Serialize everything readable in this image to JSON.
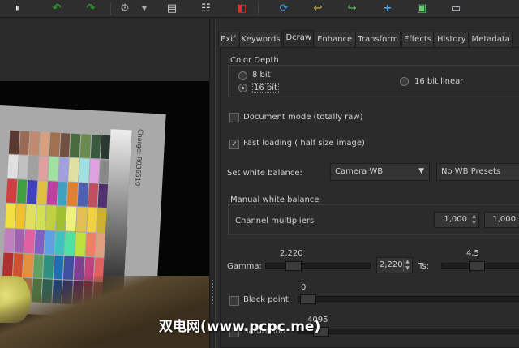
{
  "toolbar": {
    "icons": [
      "pause-icon",
      "rotate-left-icon",
      "rotate-right-icon",
      "gear-icon",
      "dropdown-arrow-icon",
      "document-icon",
      "list-add-icon",
      "exit-icon",
      "refresh-icon",
      "undo-icon",
      "redo-icon",
      "plus-icon",
      "image-icon",
      "battery-icon"
    ]
  },
  "tabs": [
    "Exif",
    "Keywords",
    "Dcraw",
    "Enhance",
    "Transform",
    "Effects",
    "History",
    "Metadata"
  ],
  "active_tab": "Dcraw",
  "dcraw": {
    "color_depth": {
      "title": "Color Depth",
      "options": [
        "8 bit",
        "16 bit",
        "16 bit linear"
      ],
      "selected": "16 bit"
    },
    "document_mode": {
      "label": "Document mode (totally raw)",
      "checked": false
    },
    "fast_loading": {
      "label": "Fast loading ( half size image)",
      "checked": true
    },
    "white_balance": {
      "label": "Set white balance:",
      "value": "Camera WB",
      "presets": "No WB Presets"
    },
    "manual_wb": {
      "title": "Manual white balance",
      "channel_label": "Channel multipliers",
      "values": [
        "1,000",
        "1,000"
      ]
    },
    "gamma": {
      "label": "Gamma:",
      "value": "2,220",
      "spin": "2,220",
      "ts_label": "Ts:",
      "ts_value": "4,5"
    },
    "black_point": {
      "label": "Black point",
      "checked": false,
      "value": "0"
    },
    "saturation": {
      "label": "Saturation",
      "checked": false,
      "value": "4095"
    }
  },
  "card_text": "Charge: R036510",
  "watermark": "双电网(www.pcpc.me)"
}
